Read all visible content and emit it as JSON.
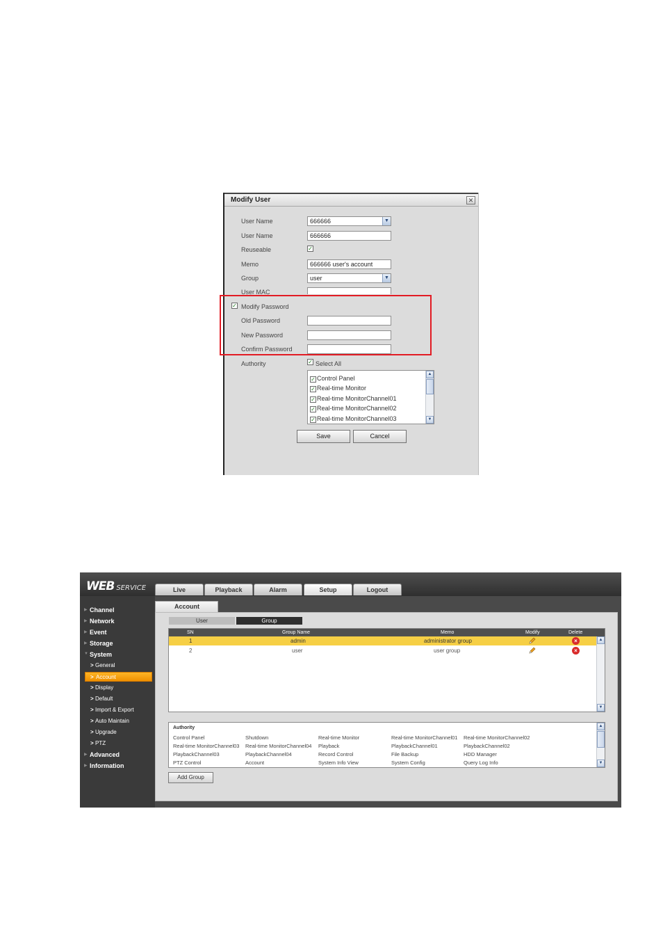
{
  "dialog": {
    "title": "Modify User",
    "close_glyph": "✕",
    "fields": [
      {
        "label": "User Name",
        "value": "666666",
        "type": "select"
      },
      {
        "label": "User Name",
        "value": "666666",
        "type": "text"
      },
      {
        "label": "Reuseable",
        "checked": true,
        "type": "checkbox"
      },
      {
        "label": "Memo",
        "value": "666666 user's account",
        "type": "text"
      },
      {
        "label": "Group",
        "value": "user",
        "type": "select"
      },
      {
        "label": "User MAC",
        "type": "mac"
      }
    ],
    "modify_password": {
      "label": "Modify Password",
      "checked": true
    },
    "password_fields": [
      "Old Password",
      "New Password",
      "Confirm Password"
    ],
    "authority": {
      "label": "Authority",
      "select_all": "Select All",
      "items": [
        "Control Panel",
        "Real-time Monitor",
        "Real-time MonitorChannel01",
        "Real-time MonitorChannel02",
        "Real-time MonitorChannel03"
      ]
    },
    "save_label": "Save",
    "cancel_label": "Cancel"
  },
  "web": {
    "logo_main": "WEB",
    "logo_sub": "SERVICE",
    "nav_tabs": [
      {
        "label": "Live",
        "active": false
      },
      {
        "label": "Playback",
        "active": false
      },
      {
        "label": "Alarm",
        "active": false
      },
      {
        "label": "Setup",
        "active": true
      },
      {
        "label": "Logout",
        "active": false
      }
    ],
    "sidebar": {
      "top": [
        "Channel",
        "Network",
        "Event",
        "Storage",
        "System"
      ],
      "system_sub": [
        "General",
        "Account",
        "Display",
        "Default",
        "Import & Export",
        "Auto Maintain",
        "Upgrade",
        "PTZ"
      ],
      "active_sub": "Account",
      "bottom": [
        "Advanced",
        "Information"
      ]
    },
    "account_tab": "Account",
    "subtabs": {
      "user": "User",
      "group": "Group"
    },
    "table": {
      "headers": {
        "sn": "SN",
        "group_name": "Group Name",
        "memo": "Memo",
        "modify": "Modify",
        "delete": "Delete"
      },
      "rows": [
        {
          "sn": "1",
          "group_name": "admin",
          "memo": "administrator group",
          "selected": true
        },
        {
          "sn": "2",
          "group_name": "user",
          "memo": "user group",
          "selected": false
        }
      ]
    },
    "authority": {
      "header": "Authority",
      "rows": [
        [
          "Control Panel",
          "Shutdown",
          "Real-time Monitor",
          "Real-time MonitorChannel01",
          "Real-time MonitorChannel02"
        ],
        [
          "Real-time MonitorChannel03",
          "Real-time MonitorChannel04",
          "Playback",
          "PlaybackChannel01",
          "PlaybackChannel02"
        ],
        [
          "PlaybackChannel03",
          "PlaybackChannel04",
          "Record Control",
          "File Backup",
          "HDD Manager"
        ],
        [
          "PTZ Control",
          "Account",
          "System Info View",
          "System Config",
          "Query Log Info"
        ]
      ]
    },
    "add_group_label": "Add Group",
    "colors": {
      "accent_orange": "#f5a51a",
      "selected_row": "#f6cf45",
      "delete_red": "#d92b2b",
      "highlight_box": "#e21b23"
    }
  }
}
